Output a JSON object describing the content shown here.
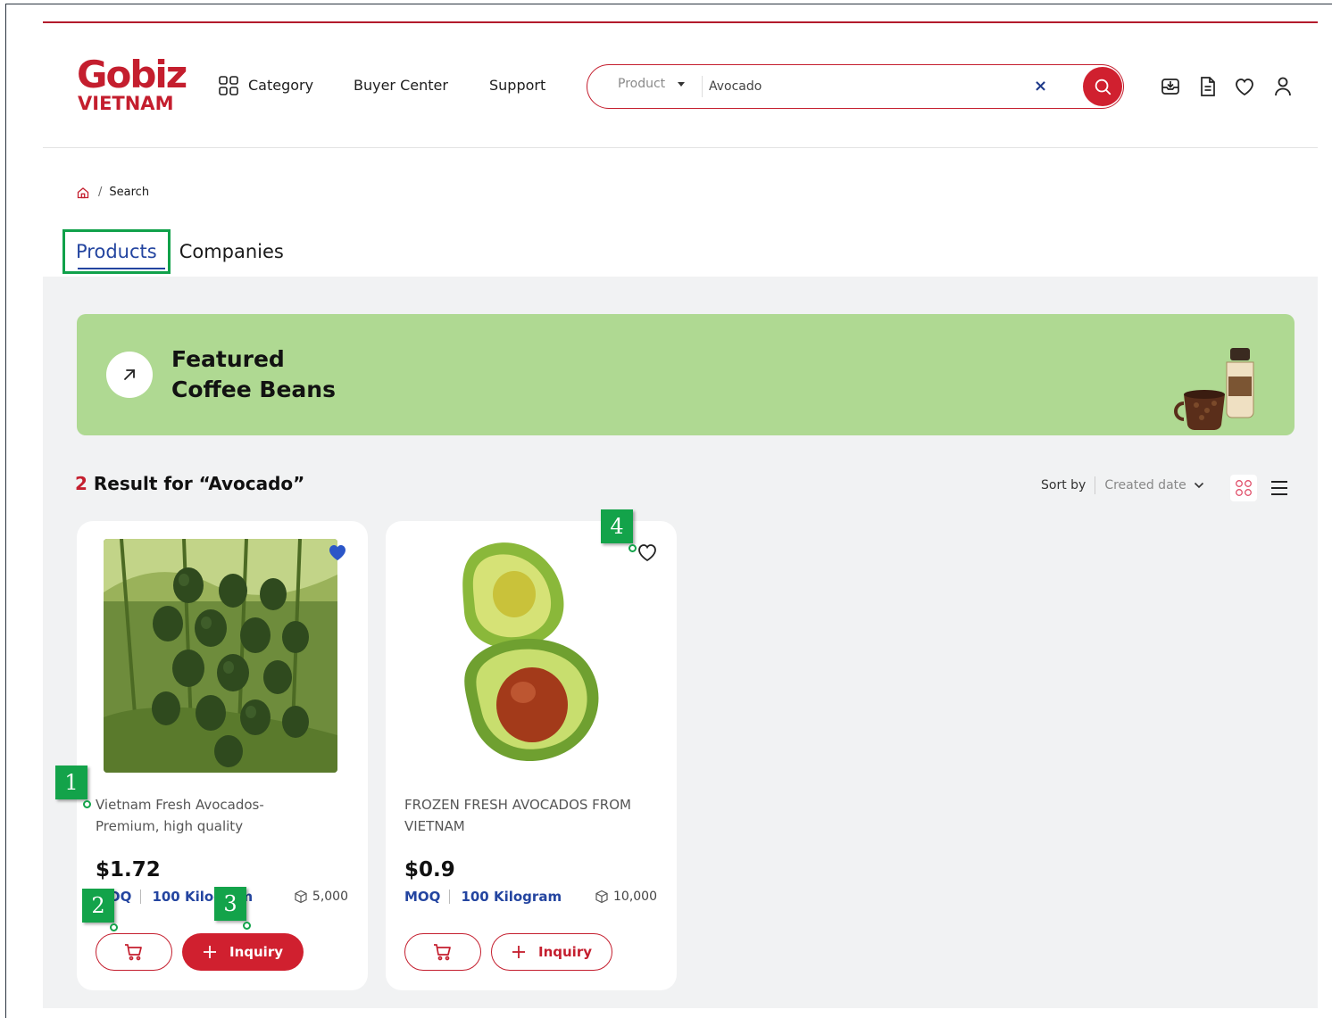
{
  "header": {
    "logo_top": "Gobiz",
    "logo_bottom": "VIETNAM",
    "nav": {
      "category": "Category",
      "buyer_center": "Buyer Center",
      "support": "Support"
    },
    "search": {
      "type_label": "Product",
      "value": "Avocado",
      "clear_glyph": "×"
    },
    "icons": [
      "inbox-download-icon",
      "document-icon",
      "heart-icon",
      "user-icon"
    ]
  },
  "breadcrumb": {
    "current": "Search"
  },
  "tabs": {
    "products": "Products",
    "companies": "Companies"
  },
  "banner": {
    "line1": "Featured",
    "line2": "Coffee Beans",
    "color": "#afd992"
  },
  "results": {
    "count": "2",
    "text": " Result for “Avocado”"
  },
  "sort": {
    "label": "Sort by",
    "value": "Created date"
  },
  "products": [
    {
      "name": "Vietnam Fresh Avocados- Premium, high quality",
      "price": "$1.72",
      "moq_label": "MOQ",
      "moq_value": "100 Kilogram",
      "stock": "5,000",
      "inquiry_label": "Inquiry",
      "favorited": true
    },
    {
      "name": "FROZEN FRESH AVOCADOS FROM VIETNAM",
      "price": "$0.9",
      "moq_label": "MOQ",
      "moq_value": "100 Kilogram",
      "stock": "10,000",
      "inquiry_label": "Inquiry",
      "favorited": false
    }
  ],
  "markers": [
    "1",
    "2",
    "3",
    "4"
  ],
  "colors": {
    "brand_red": "#c41e2e",
    "link_blue": "#2445a0",
    "marker_green": "#13a34a"
  }
}
